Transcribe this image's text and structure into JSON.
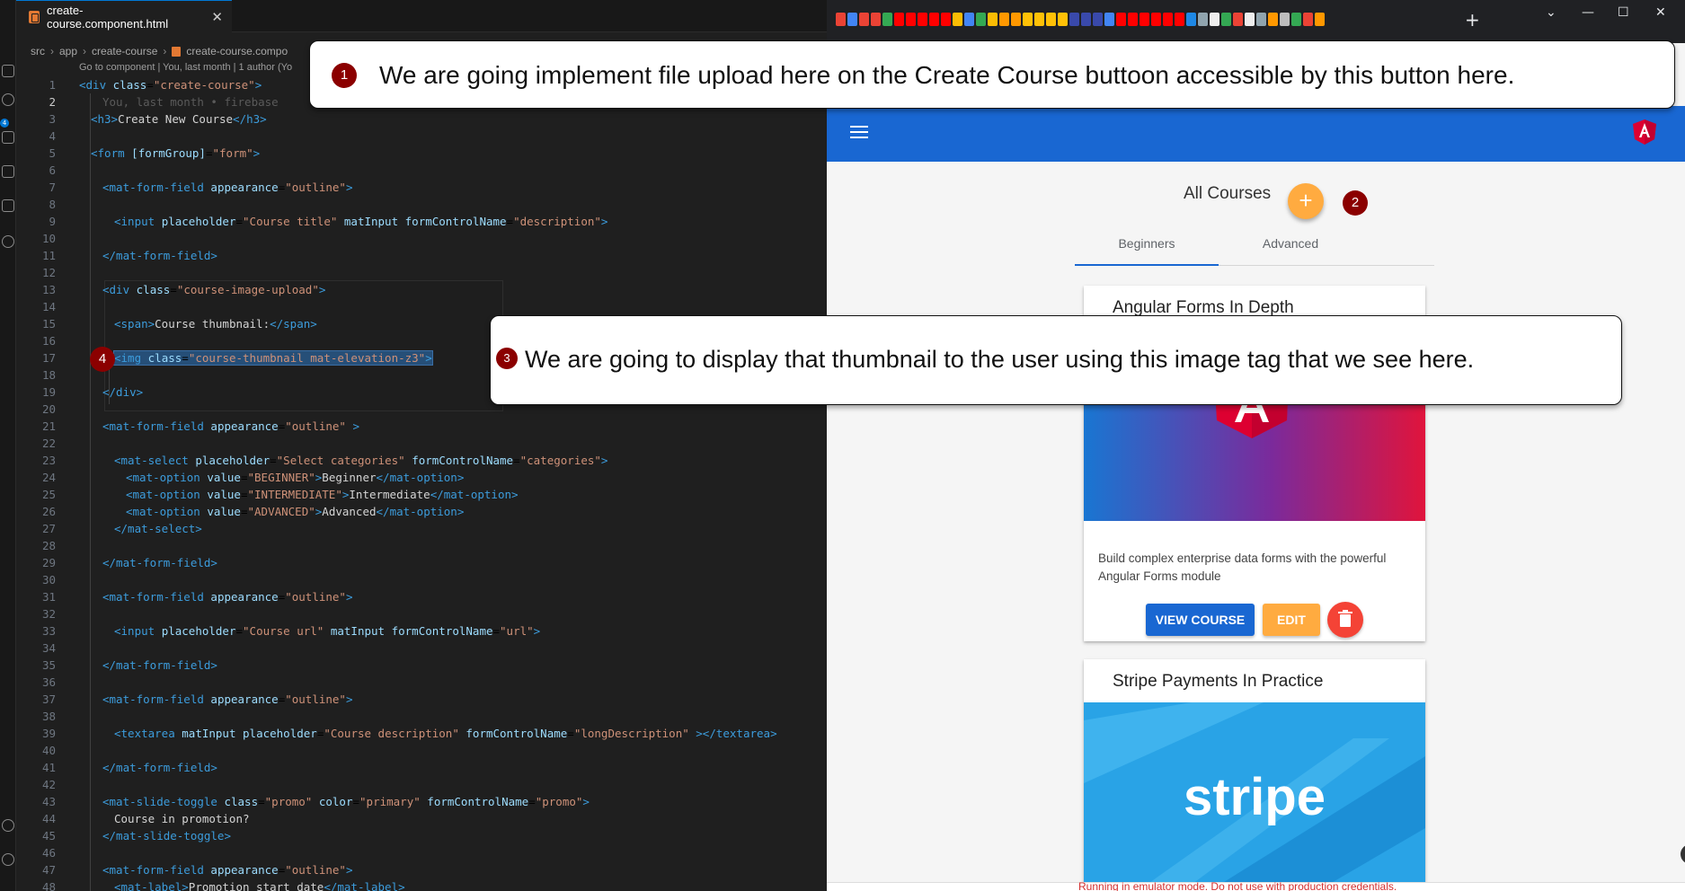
{
  "editor": {
    "tab": {
      "label": "create-course.component.html",
      "close": "✕"
    },
    "breadcrumb": {
      "parts": [
        "src",
        "app",
        "create-course",
        "create-course.compo"
      ]
    },
    "codelens": "Go to component | You, last month | 1 author (Yo",
    "ghost_text": "You, last month • firebase",
    "lines": [
      {
        "n": "1",
        "indent": 0,
        "html": "<span class=\"tag\">&lt;div</span> <span class=\"attr\">class</span>=<span class=\"str\">\"create-course\"</span><span class=\"tag\">&gt;</span>"
      },
      {
        "n": "2",
        "indent": 0,
        "html": ""
      },
      {
        "n": "3",
        "indent": 1,
        "html": "<span class=\"tag\">&lt;h3&gt;</span><span class=\"txt\">Create New Course</span><span class=\"tag\">&lt;/h3&gt;</span>"
      },
      {
        "n": "4",
        "indent": 0,
        "html": ""
      },
      {
        "n": "5",
        "indent": 1,
        "html": "<span class=\"tag\">&lt;form</span> <span class=\"attr\">[formGroup]</span>=<span class=\"str\">\"form\"</span><span class=\"tag\">&gt;</span>"
      },
      {
        "n": "6",
        "indent": 0,
        "html": ""
      },
      {
        "n": "7",
        "indent": 2,
        "html": "<span class=\"tag\">&lt;mat-form-field</span> <span class=\"attr\">appearance</span>=<span class=\"str\">\"outline\"</span><span class=\"tag\">&gt;</span>"
      },
      {
        "n": "8",
        "indent": 0,
        "html": ""
      },
      {
        "n": "9",
        "indent": 3,
        "html": "<span class=\"tag\">&lt;input</span> <span class=\"attr\">placeholder</span>=<span class=\"str\">\"Course title\"</span> <span class=\"attr\">matInput</span> <span class=\"attr\">formControlName</span>=<span class=\"str\">\"description\"</span><span class=\"tag\">&gt;</span>"
      },
      {
        "n": "10",
        "indent": 0,
        "html": ""
      },
      {
        "n": "11",
        "indent": 2,
        "html": "<span class=\"tag\">&lt;/mat-form-field&gt;</span>"
      },
      {
        "n": "12",
        "indent": 0,
        "html": ""
      },
      {
        "n": "13",
        "indent": 2,
        "html": "<span class=\"tag\">&lt;div</span> <span class=\"attr\">class</span>=<span class=\"str\">\"course-image-upload\"</span><span class=\"tag\">&gt;</span>"
      },
      {
        "n": "14",
        "indent": 0,
        "html": ""
      },
      {
        "n": "15",
        "indent": 3,
        "html": "<span class=\"tag\">&lt;span&gt;</span><span class=\"txt\">Course thumbnail:</span><span class=\"tag\">&lt;/span&gt;</span>"
      },
      {
        "n": "16",
        "indent": 0,
        "html": ""
      },
      {
        "n": "17",
        "indent": 3,
        "html": "<span class=\"sel\"><span class=\"tag\">&lt;img</span> <span class=\"attr\">class</span>=<span class=\"str\">\"course-thumbnail mat-elevation-z3\"</span><span class=\"tag\">&gt;</span></span>"
      },
      {
        "n": "18",
        "indent": 0,
        "html": ""
      },
      {
        "n": "19",
        "indent": 2,
        "html": "<span class=\"tag\">&lt;/div&gt;</span>"
      },
      {
        "n": "20",
        "indent": 0,
        "html": ""
      },
      {
        "n": "21",
        "indent": 2,
        "html": "<span class=\"tag\">&lt;mat-form-field</span> <span class=\"attr\">appearance</span>=<span class=\"str\">\"outline\"</span> <span class=\"tag\">&gt;</span>"
      },
      {
        "n": "22",
        "indent": 0,
        "html": ""
      },
      {
        "n": "23",
        "indent": 3,
        "html": "<span class=\"tag\">&lt;mat-select</span> <span class=\"attr\">placeholder</span>=<span class=\"str\">\"Select categories\"</span> <span class=\"attr\">formControlName</span>=<span class=\"str\">\"categories\"</span><span class=\"tag\">&gt;</span>"
      },
      {
        "n": "24",
        "indent": 4,
        "html": "<span class=\"tag\">&lt;mat-option</span> <span class=\"attr\">value</span>=<span class=\"str\">\"BEGINNER\"</span><span class=\"tag\">&gt;</span><span class=\"txt\">Beginner</span><span class=\"tag\">&lt;/mat-option&gt;</span>"
      },
      {
        "n": "25",
        "indent": 4,
        "html": "<span class=\"tag\">&lt;mat-option</span> <span class=\"attr\">value</span>=<span class=\"str\">\"INTERMEDIATE\"</span><span class=\"tag\">&gt;</span><span class=\"txt\">Intermediate</span><span class=\"tag\">&lt;/mat-option&gt;</span>"
      },
      {
        "n": "26",
        "indent": 4,
        "html": "<span class=\"tag\">&lt;mat-option</span> <span class=\"attr\">value</span>=<span class=\"str\">\"ADVANCED\"</span><span class=\"tag\">&gt;</span><span class=\"txt\">Advanced</span><span class=\"tag\">&lt;/mat-option&gt;</span>"
      },
      {
        "n": "27",
        "indent": 3,
        "html": "<span class=\"tag\">&lt;/mat-select&gt;</span>"
      },
      {
        "n": "28",
        "indent": 0,
        "html": ""
      },
      {
        "n": "29",
        "indent": 2,
        "html": "<span class=\"tag\">&lt;/mat-form-field&gt;</span>"
      },
      {
        "n": "30",
        "indent": 0,
        "html": ""
      },
      {
        "n": "31",
        "indent": 2,
        "html": "<span class=\"tag\">&lt;mat-form-field</span> <span class=\"attr\">appearance</span>=<span class=\"str\">\"outline\"</span><span class=\"tag\">&gt;</span>"
      },
      {
        "n": "32",
        "indent": 0,
        "html": ""
      },
      {
        "n": "33",
        "indent": 3,
        "html": "<span class=\"tag\">&lt;input</span> <span class=\"attr\">placeholder</span>=<span class=\"str\">\"Course url\"</span> <span class=\"attr\">matInput</span> <span class=\"attr\">formControlName</span>=<span class=\"str\">\"url\"</span><span class=\"tag\">&gt;</span>"
      },
      {
        "n": "34",
        "indent": 0,
        "html": ""
      },
      {
        "n": "35",
        "indent": 2,
        "html": "<span class=\"tag\">&lt;/mat-form-field&gt;</span>"
      },
      {
        "n": "36",
        "indent": 0,
        "html": ""
      },
      {
        "n": "37",
        "indent": 2,
        "html": "<span class=\"tag\">&lt;mat-form-field</span> <span class=\"attr\">appearance</span>=<span class=\"str\">\"outline\"</span><span class=\"tag\">&gt;</span>"
      },
      {
        "n": "38",
        "indent": 0,
        "html": ""
      },
      {
        "n": "39",
        "indent": 3,
        "html": "<span class=\"tag\">&lt;textarea</span> <span class=\"attr\">matInput</span> <span class=\"attr\">placeholder</span>=<span class=\"str\">\"Course description\"</span> <span class=\"attr\">formControlName</span>=<span class=\"str\">\"longDescription\"</span> <span class=\"tag\">&gt;&lt;/textarea&gt;</span>"
      },
      {
        "n": "40",
        "indent": 0,
        "html": ""
      },
      {
        "n": "41",
        "indent": 2,
        "html": "<span class=\"tag\">&lt;/mat-form-field&gt;</span>"
      },
      {
        "n": "42",
        "indent": 0,
        "html": ""
      },
      {
        "n": "43",
        "indent": 2,
        "html": "<span class=\"tag\">&lt;mat-slide-toggle</span> <span class=\"attr\">class</span>=<span class=\"str\">\"promo\"</span> <span class=\"attr\">color</span>=<span class=\"str\">\"primary\"</span> <span class=\"attr\">formControlName</span>=<span class=\"str\">\"promo\"</span><span class=\"tag\">&gt;</span>"
      },
      {
        "n": "44",
        "indent": 3,
        "html": "<span class=\"txt\">Course in promotion?</span>"
      },
      {
        "n": "45",
        "indent": 2,
        "html": "<span class=\"tag\">&lt;/mat-slide-toggle&gt;</span>"
      },
      {
        "n": "46",
        "indent": 0,
        "html": ""
      },
      {
        "n": "47",
        "indent": 2,
        "html": "<span class=\"tag\">&lt;mat-form-field</span> <span class=\"attr\">appearance</span>=<span class=\"str\">\"outline\"</span><span class=\"tag\">&gt;</span>"
      },
      {
        "n": "48",
        "indent": 3,
        "html": "<span class=\"tag\">&lt;mat-label&gt;</span><span class=\"txt\">Promotion start date</span><span class=\"tag\">&lt;/mat-label&gt;</span>"
      }
    ]
  },
  "browser": {
    "new_tab": "+",
    "window_controls": [
      "⌄",
      "—",
      "☐",
      "✕"
    ],
    "page": {
      "title": "All Courses",
      "fab_label": "+",
      "tabs": [
        "Beginners",
        "Advanced"
      ],
      "cards": [
        {
          "title": "Angular Forms In Depth",
          "description": "Build complex enterprise data forms with the powerful Angular Forms module",
          "view_label": "VIEW COURSE",
          "edit_label": "EDIT"
        },
        {
          "title": "Stripe Payments In Practice",
          "image_text": "stripe"
        }
      ],
      "footer": "Running in emulator mode. Do not use with production credentials."
    }
  },
  "callouts": [
    {
      "num": "1",
      "text": "We are going implement file upload here on the Create Course buttoon accessible by this button here."
    },
    {
      "num": "2"
    },
    {
      "num": "3",
      "text": "We are going to display that thumbnail to the user  using this image tag that we see here."
    },
    {
      "num": "4"
    }
  ],
  "colors": {
    "toolbar": "#1967d2",
    "accent": "#ffab40",
    "warn": "#f44336",
    "callout_badge": "#8b0000"
  }
}
